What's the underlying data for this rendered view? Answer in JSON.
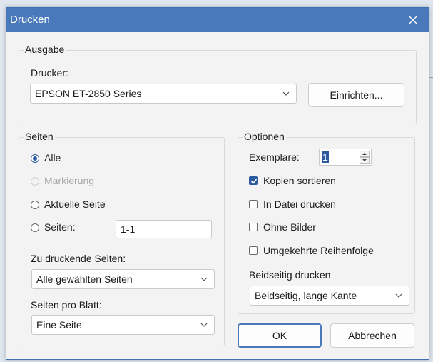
{
  "window": {
    "title": "Drucken"
  },
  "ausgabe": {
    "legend": "Ausgabe",
    "drucker_label": "Drucker:",
    "drucker_value": "EPSON ET-2850 Series",
    "einrichten_button": "Einrichten..."
  },
  "seiten": {
    "legend": "Seiten",
    "options": [
      {
        "label": "Alle",
        "checked": true,
        "disabled": false
      },
      {
        "label": "Markierung",
        "checked": false,
        "disabled": true
      },
      {
        "label": "Aktuelle Seite",
        "checked": false,
        "disabled": false
      },
      {
        "label": "Seiten:",
        "checked": false,
        "disabled": false
      }
    ],
    "seiten_range_value": "1-1",
    "zu_druckende_label": "Zu druckende Seiten:",
    "zu_druckende_value": "Alle gewählten Seiten",
    "pro_blatt_label": "Seiten pro Blatt:",
    "pro_blatt_value": "Eine Seite"
  },
  "optionen": {
    "legend": "Optionen",
    "exemplare_label": "Exemplare:",
    "exemplare_value": "1",
    "checkboxes": [
      {
        "label": "Kopien sortieren",
        "checked": true
      },
      {
        "label": "In Datei drucken",
        "checked": false
      },
      {
        "label": "Ohne Bilder",
        "checked": false
      },
      {
        "label": "Umgekehrte Reihenfolge",
        "checked": false
      }
    ],
    "beidseitig_label": "Beidseitig drucken",
    "beidseitig_value": "Beidseitig, lange Kante"
  },
  "buttons": {
    "ok": "OK",
    "abbrechen": "Abbrechen"
  },
  "colors": {
    "titlebar": "#4a79bb",
    "accent": "#2c5aa0"
  }
}
